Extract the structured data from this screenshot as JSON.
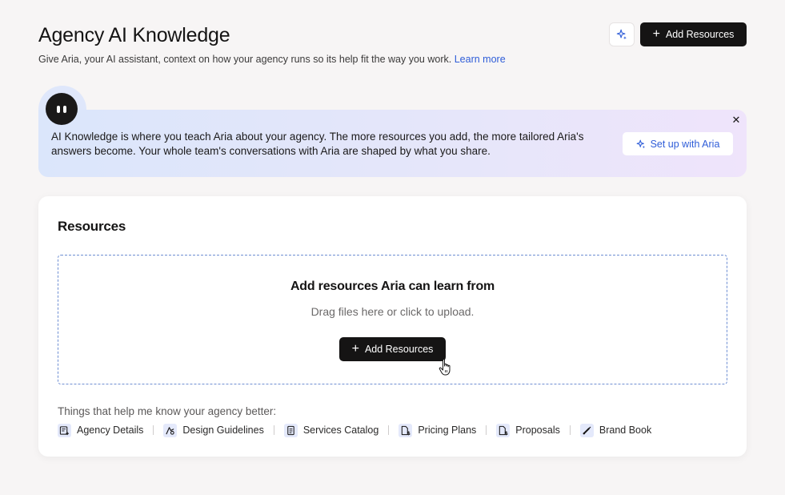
{
  "header": {
    "title": "Agency AI Knowledge",
    "subtitle": "Give Aria, your AI assistant, context on how your agency runs so its help fit the way you work.",
    "learn_more": "Learn more",
    "add_resources_label": "Add Resources"
  },
  "banner": {
    "text": "AI Knowledge is where you teach Aria about your agency. The more resources you add, the more tailored Aria's answers become. Your whole team's conversations with Aria are shaped by what you share.",
    "close_glyph": "✕",
    "setup_label": "Set up with Aria"
  },
  "resources": {
    "title": "Resources",
    "dropzone": {
      "title": "Add resources Aria can learn from",
      "subtitle": "Drag files here or click to upload.",
      "button_label": "Add Resources"
    },
    "hint": "Things that help me know your agency better:",
    "chips": [
      {
        "label": "Agency Details",
        "icon": "agency-details-icon"
      },
      {
        "label": "Design Guidelines",
        "icon": "design-guidelines-icon"
      },
      {
        "label": "Services Catalog",
        "icon": "services-catalog-icon"
      },
      {
        "label": "Pricing Plans",
        "icon": "pricing-plans-icon"
      },
      {
        "label": "Proposals",
        "icon": "proposals-icon"
      },
      {
        "label": "Brand Book",
        "icon": "brand-book-icon"
      }
    ]
  },
  "colors": {
    "accent": "#2f5dd8",
    "dark_button": "#151414",
    "background": "#f7f5f5"
  }
}
